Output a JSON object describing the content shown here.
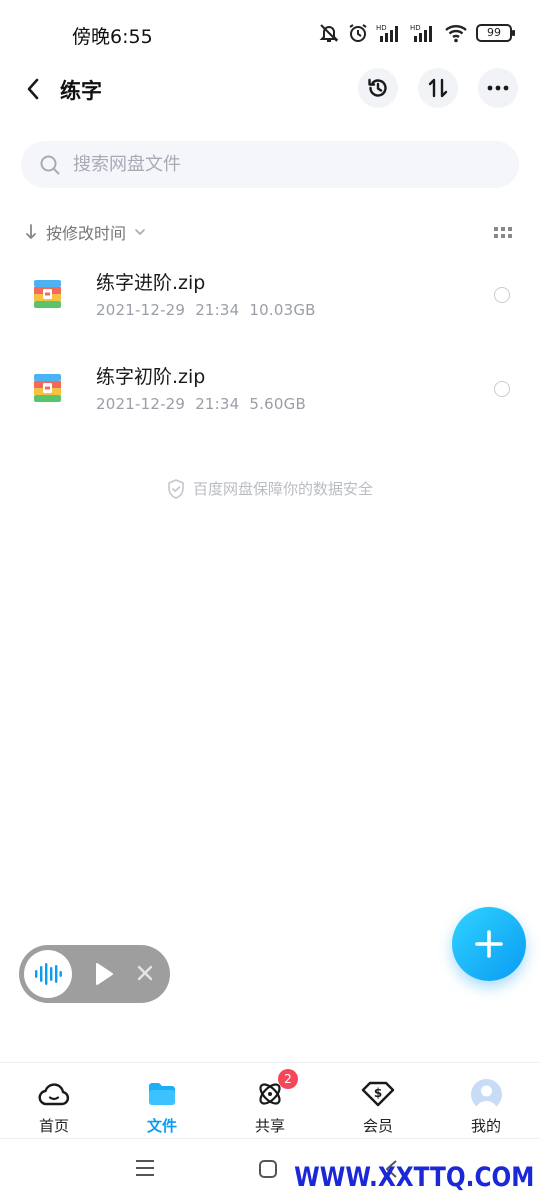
{
  "status_bar": {
    "time": "傍晚6:55",
    "battery": "99",
    "icons": [
      "mute-icon",
      "alarm-icon",
      "signal-hd-icon",
      "signal-hd-icon",
      "wifi-icon",
      "battery-icon"
    ]
  },
  "header": {
    "title": "练字",
    "icons": [
      "back-icon",
      "history-icon",
      "transfer-icon",
      "more-icon"
    ]
  },
  "search": {
    "placeholder": "搜索网盘文件"
  },
  "sort": {
    "label": "按修改时间"
  },
  "files": [
    {
      "name": "练字进阶.zip",
      "date": "2021-12-29",
      "time": "21:34",
      "size": "10.03GB"
    },
    {
      "name": "练字初阶.zip",
      "date": "2021-12-29",
      "time": "21:34",
      "size": "5.60GB"
    }
  ],
  "security_note": "百度网盘保障你的数据安全",
  "bottom_nav": {
    "items": [
      {
        "label": "首页"
      },
      {
        "label": "文件"
      },
      {
        "label": "共享",
        "badge": "2"
      },
      {
        "label": "会员"
      },
      {
        "label": "我的"
      }
    ],
    "active": "文件"
  },
  "colors": {
    "accent": "#0a9bf3",
    "badge": "#f5465a",
    "watermark": "#1b28d8"
  },
  "watermark": "WWW.XXTTQ.COM"
}
